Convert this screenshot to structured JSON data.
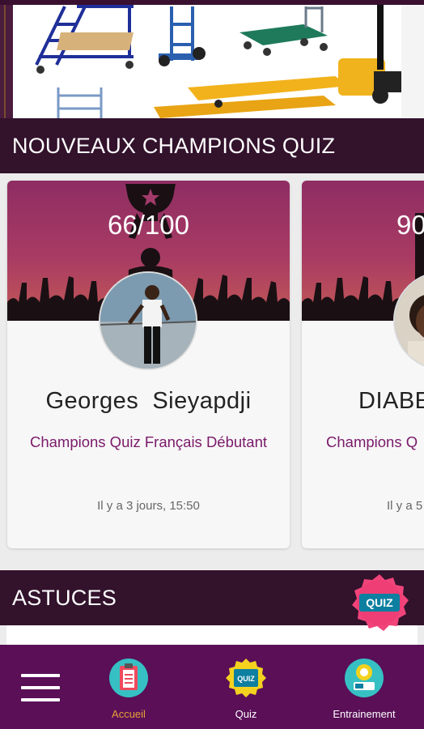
{
  "sections": {
    "champions_title": "NOUVEAUX CHAMPIONS QUIZ",
    "astuces_title": "ASTUCES"
  },
  "champions": [
    {
      "score": "66/100",
      "name": "Georges  Sieyapdji",
      "category": "Champions Quiz Français Débutant",
      "time": "Il y a 3 jours, 15:50"
    },
    {
      "score": "90",
      "name": "DIABE",
      "category": "Champions Q",
      "time": "Il y a 5"
    }
  ],
  "badge": {
    "label": "QUIZ"
  },
  "bottom_nav": {
    "items": [
      {
        "label": "Accueil",
        "icon": "clipboard-icon"
      },
      {
        "label": "Quiz",
        "icon": "quiz-icon"
      },
      {
        "label": "Entrainement",
        "icon": "training-icon"
      }
    ],
    "menu_icon": "hamburger-menu-icon"
  },
  "colors": {
    "header_bg": "#33122c",
    "nav_bg": "#5a0f57",
    "active_label": "#e8a13a",
    "category_text": "#7a1a6a"
  }
}
